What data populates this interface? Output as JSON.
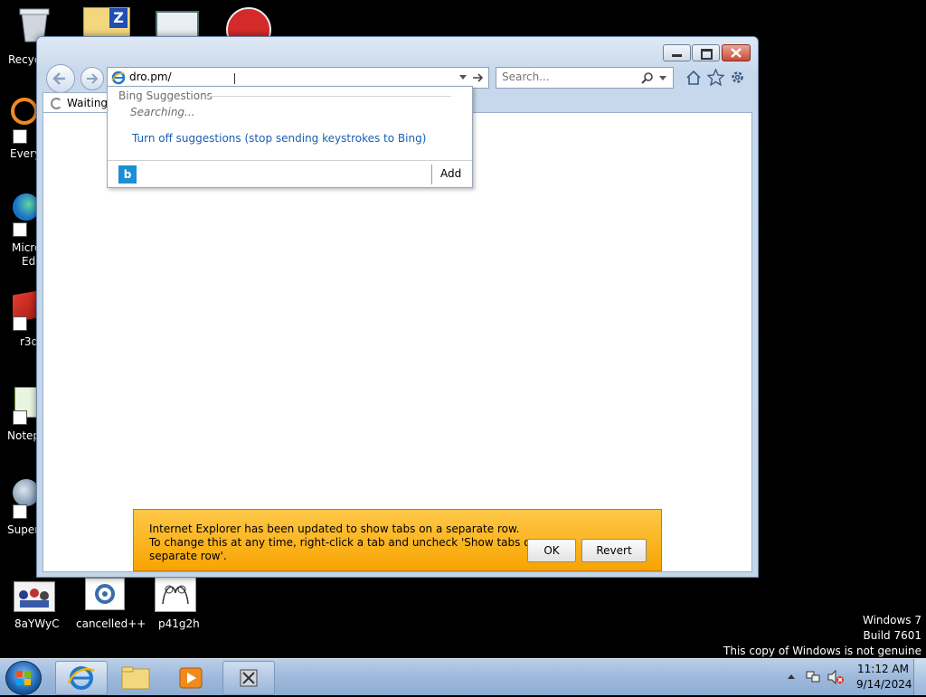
{
  "desktop": {
    "icons": [
      {
        "name": "recycle-bin",
        "label": "Recyc"
      },
      {
        "name": "everything",
        "label": "Every"
      },
      {
        "name": "microsoft-edge",
        "label": "Micro"
      },
      {
        "name": "microsoft-edge-2",
        "label": "Ed"
      },
      {
        "name": "r3d",
        "label": "r3d"
      },
      {
        "name": "notepad",
        "label": "Notep"
      },
      {
        "name": "super",
        "label": "Super"
      }
    ],
    "bottom_icons": [
      {
        "name": "8aywyc",
        "label": "8aYWyC"
      },
      {
        "name": "cancelled",
        "label": "cancelled++"
      },
      {
        "name": "p41g2h",
        "label": "p41g2h"
      }
    ],
    "watermark": {
      "line1": "Windows 7",
      "line2": "Build 7601",
      "line3": "This copy of Windows is not genuine"
    }
  },
  "browser": {
    "address": "dro.pm/",
    "search_placeholder": "Search...",
    "tab_label": "Waiting",
    "suggestions": {
      "header": "Bing Suggestions",
      "status": "Searching...",
      "turn_off": "Turn off suggestions (stop sending keystrokes to Bing)",
      "add": "Add"
    },
    "notification": {
      "line1": "Internet Explorer has been updated to show tabs on a separate row.",
      "line2": "To change this at any time, right-click a tab and uncheck 'Show tabs on a",
      "line3": "separate row'.",
      "ok": "OK",
      "revert": "Revert"
    }
  },
  "taskbar": {
    "time": "11:12 AM",
    "date": "9/14/2024"
  },
  "colors": {
    "accent": "#1a5fb4",
    "notification": "#f7a400"
  }
}
